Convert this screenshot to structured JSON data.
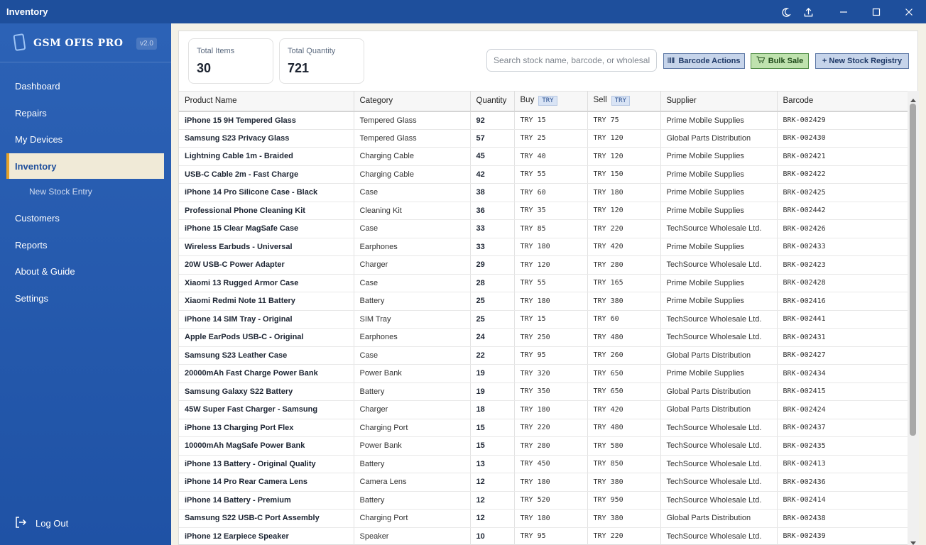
{
  "window": {
    "title": "Inventory"
  },
  "brand": {
    "name": "GSM OFIS PRO",
    "version": "v2.0"
  },
  "nav": {
    "dashboard": "Dashboard",
    "repairs": "Repairs",
    "my_devices": "My Devices",
    "inventory": "Inventory",
    "new_stock_entry": "New Stock Entry",
    "customers": "Customers",
    "reports": "Reports",
    "about": "About & Guide",
    "settings": "Settings",
    "logout": "Log Out"
  },
  "stats": {
    "total_items_label": "Total Items",
    "total_items_value": "30",
    "total_quantity_label": "Total Quantity",
    "total_quantity_value": "721"
  },
  "search": {
    "placeholder": "Search stock name, barcode, or wholesaler..."
  },
  "actions": {
    "barcode": "Barcode Actions",
    "bulk_sale": "Bulk Sale",
    "new_stock": "+ New Stock Registry"
  },
  "table": {
    "headers": {
      "name": "Product Name",
      "category": "Category",
      "quantity": "Quantity",
      "buy": "Buy",
      "sell": "Sell",
      "supplier": "Supplier",
      "barcode": "Barcode",
      "currency": "TRY"
    },
    "rows": [
      {
        "name": "iPhone 15 9H Tempered Glass",
        "category": "Tempered Glass",
        "qty": "92",
        "buy": "TRY 15",
        "sell": "TRY 75",
        "supplier": "Prime Mobile Supplies",
        "barcode": "BRK-002429"
      },
      {
        "name": "Samsung S23 Privacy Glass",
        "category": "Tempered Glass",
        "qty": "57",
        "buy": "TRY 25",
        "sell": "TRY 120",
        "supplier": "Global Parts Distribution",
        "barcode": "BRK-002430"
      },
      {
        "name": "Lightning Cable 1m - Braided",
        "category": "Charging Cable",
        "qty": "45",
        "buy": "TRY 40",
        "sell": "TRY 120",
        "supplier": "Prime Mobile Supplies",
        "barcode": "BRK-002421"
      },
      {
        "name": "USB-C Cable 2m - Fast Charge",
        "category": "Charging Cable",
        "qty": "42",
        "buy": "TRY 55",
        "sell": "TRY 150",
        "supplier": "Prime Mobile Supplies",
        "barcode": "BRK-002422"
      },
      {
        "name": "iPhone 14 Pro Silicone Case - Black",
        "category": "Case",
        "qty": "38",
        "buy": "TRY 60",
        "sell": "TRY 180",
        "supplier": "Prime Mobile Supplies",
        "barcode": "BRK-002425"
      },
      {
        "name": "Professional Phone Cleaning Kit",
        "category": "Cleaning Kit",
        "qty": "36",
        "buy": "TRY 35",
        "sell": "TRY 120",
        "supplier": "Prime Mobile Supplies",
        "barcode": "BRK-002442"
      },
      {
        "name": "iPhone 15 Clear MagSafe Case",
        "category": "Case",
        "qty": "33",
        "buy": "TRY 85",
        "sell": "TRY 220",
        "supplier": "TechSource Wholesale Ltd.",
        "barcode": "BRK-002426"
      },
      {
        "name": "Wireless Earbuds - Universal",
        "category": "Earphones",
        "qty": "33",
        "buy": "TRY 180",
        "sell": "TRY 420",
        "supplier": "Prime Mobile Supplies",
        "barcode": "BRK-002433"
      },
      {
        "name": "20W USB-C Power Adapter",
        "category": "Charger",
        "qty": "29",
        "buy": "TRY 120",
        "sell": "TRY 280",
        "supplier": "TechSource Wholesale Ltd.",
        "barcode": "BRK-002423"
      },
      {
        "name": "Xiaomi 13 Rugged Armor Case",
        "category": "Case",
        "qty": "28",
        "buy": "TRY 55",
        "sell": "TRY 165",
        "supplier": "Prime Mobile Supplies",
        "barcode": "BRK-002428"
      },
      {
        "name": "Xiaomi Redmi Note 11 Battery",
        "category": "Battery",
        "qty": "25",
        "buy": "TRY 180",
        "sell": "TRY 380",
        "supplier": "Prime Mobile Supplies",
        "barcode": "BRK-002416"
      },
      {
        "name": "iPhone 14 SIM Tray - Original",
        "category": "SIM Tray",
        "qty": "25",
        "buy": "TRY 15",
        "sell": "TRY 60",
        "supplier": "TechSource Wholesale Ltd.",
        "barcode": "BRK-002441"
      },
      {
        "name": "Apple EarPods USB-C - Original",
        "category": "Earphones",
        "qty": "24",
        "buy": "TRY 250",
        "sell": "TRY 480",
        "supplier": "TechSource Wholesale Ltd.",
        "barcode": "BRK-002431"
      },
      {
        "name": "Samsung S23 Leather Case",
        "category": "Case",
        "qty": "22",
        "buy": "TRY 95",
        "sell": "TRY 260",
        "supplier": "Global Parts Distribution",
        "barcode": "BRK-002427"
      },
      {
        "name": "20000mAh Fast Charge Power Bank",
        "category": "Power Bank",
        "qty": "19",
        "buy": "TRY 320",
        "sell": "TRY 650",
        "supplier": "Prime Mobile Supplies",
        "barcode": "BRK-002434"
      },
      {
        "name": "Samsung Galaxy S22 Battery",
        "category": "Battery",
        "qty": "19",
        "buy": "TRY 350",
        "sell": "TRY 650",
        "supplier": "Global Parts Distribution",
        "barcode": "BRK-002415"
      },
      {
        "name": "45W Super Fast Charger - Samsung",
        "category": "Charger",
        "qty": "18",
        "buy": "TRY 180",
        "sell": "TRY 420",
        "supplier": "Global Parts Distribution",
        "barcode": "BRK-002424"
      },
      {
        "name": "iPhone 13 Charging Port Flex",
        "category": "Charging Port",
        "qty": "15",
        "buy": "TRY 220",
        "sell": "TRY 480",
        "supplier": "TechSource Wholesale Ltd.",
        "barcode": "BRK-002437"
      },
      {
        "name": "10000mAh MagSafe Power Bank",
        "category": "Power Bank",
        "qty": "15",
        "buy": "TRY 280",
        "sell": "TRY 580",
        "supplier": "TechSource Wholesale Ltd.",
        "barcode": "BRK-002435"
      },
      {
        "name": "iPhone 13 Battery - Original Quality",
        "category": "Battery",
        "qty": "13",
        "buy": "TRY 450",
        "sell": "TRY 850",
        "supplier": "TechSource Wholesale Ltd.",
        "barcode": "BRK-002413"
      },
      {
        "name": "iPhone 14 Pro Rear Camera Lens",
        "category": "Camera Lens",
        "qty": "12",
        "buy": "TRY 180",
        "sell": "TRY 380",
        "supplier": "TechSource Wholesale Ltd.",
        "barcode": "BRK-002436"
      },
      {
        "name": "iPhone 14 Battery - Premium",
        "category": "Battery",
        "qty": "12",
        "buy": "TRY 520",
        "sell": "TRY 950",
        "supplier": "TechSource Wholesale Ltd.",
        "barcode": "BRK-002414"
      },
      {
        "name": "Samsung S22 USB-C Port Assembly",
        "category": "Charging Port",
        "qty": "12",
        "buy": "TRY 180",
        "sell": "TRY 380",
        "supplier": "Global Parts Distribution",
        "barcode": "BRK-002438"
      },
      {
        "name": "iPhone 12 Earpiece Speaker",
        "category": "Speaker",
        "qty": "10",
        "buy": "TRY 95",
        "sell": "TRY 220",
        "supplier": "TechSource Wholesale Ltd.",
        "barcode": "BRK-002439"
      }
    ]
  },
  "colors": {
    "titlebar": "#1e4f9c",
    "sidebar": "#2c62b6",
    "active_nav_bg": "#f0ead7",
    "active_nav_accent": "#e5a22a",
    "bulk_sale_bg": "#bfe2ae"
  }
}
